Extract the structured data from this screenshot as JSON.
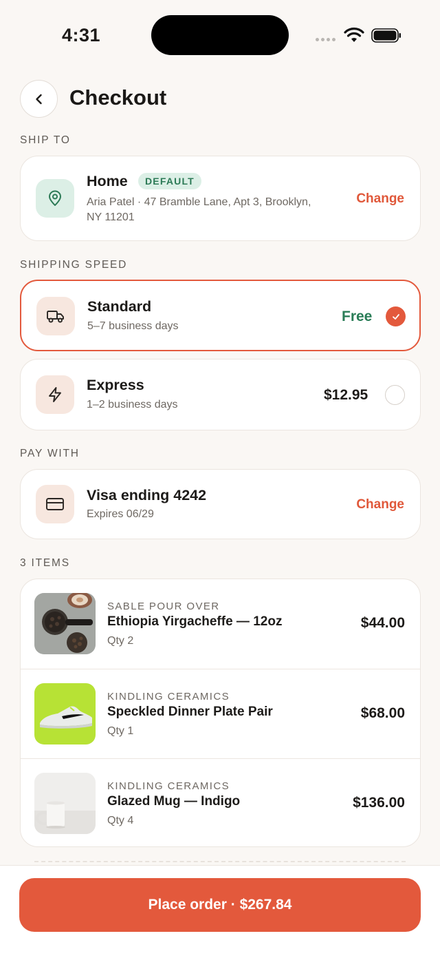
{
  "status_bar": {
    "time": "4:31"
  },
  "header": {
    "title": "Checkout"
  },
  "ship_to": {
    "section_label": "SHIP TO",
    "name": "Home",
    "badge": "DEFAULT",
    "address_line1": "Aria Patel · 47 Bramble Lane, Apt 3, Brooklyn,",
    "address_line2": "NY 11201",
    "change_label": "Change",
    "icon": "location-pin-icon"
  },
  "shipping_speed": {
    "section_label": "SHIPPING SPEED",
    "options": [
      {
        "name": "Standard",
        "eta": "5–7 business days",
        "price": "Free",
        "selected": true,
        "icon": "truck-icon"
      },
      {
        "name": "Express",
        "eta": "1–2 business days",
        "price": "$12.95",
        "selected": false,
        "icon": "lightning-icon"
      }
    ]
  },
  "payment": {
    "section_label": "PAY WITH",
    "method": "Visa ending 4242",
    "expires": "Expires 06/29",
    "change_label": "Change",
    "icon": "credit-card-icon"
  },
  "items": {
    "section_label": "3 ITEMS",
    "list": [
      {
        "brand": "SABLE POUR OVER",
        "name": "Ethiopia Yirgacheffe — 12oz",
        "qty": "Qty 2",
        "price": "$44.00"
      },
      {
        "brand": "KINDLING CERAMICS",
        "name": "Speckled Dinner Plate Pair",
        "qty": "Qty 1",
        "price": "$68.00"
      },
      {
        "brand": "KINDLING CERAMICS",
        "name": "Glazed Mug — Indigo",
        "qty": "Qty 4",
        "price": "$136.00"
      }
    ]
  },
  "cta": {
    "label": "Place order · $267.84"
  },
  "colors": {
    "accent": "#e3593c",
    "success": "#2a7d57",
    "background": "#faf7f4"
  }
}
